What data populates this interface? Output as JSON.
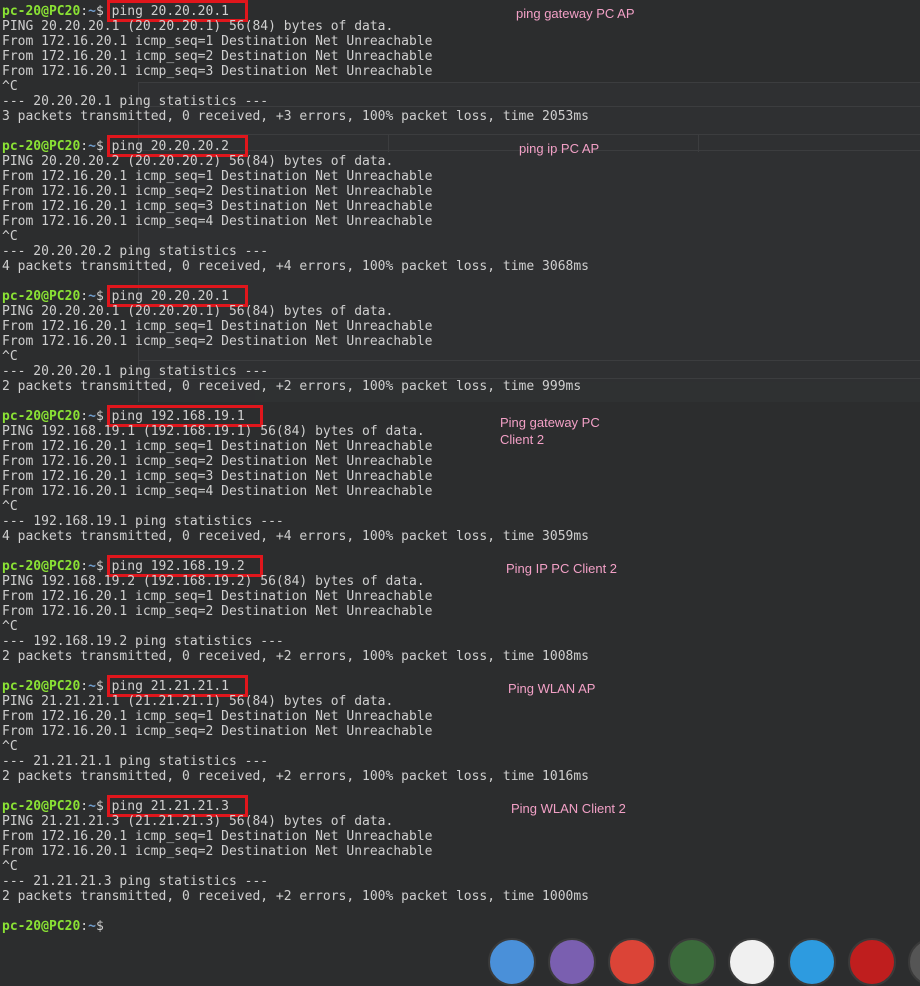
{
  "terminal": {
    "prompt_user": "pc-20@PC20",
    "prompt_path": "~",
    "blocks": [
      {
        "cmd": "ping 20.20.20.1",
        "lines": [
          "PING 20.20.20.1 (20.20.20.1) 56(84) bytes of data.",
          "From 172.16.20.1 icmp_seq=1 Destination Net Unreachable",
          "From 172.16.20.1 icmp_seq=2 Destination Net Unreachable",
          "From 172.16.20.1 icmp_seq=3 Destination Net Unreachable",
          "^C",
          "--- 20.20.20.1 ping statistics ---",
          "3 packets transmitted, 0 received, +3 errors, 100% packet loss, time 2053ms"
        ],
        "note": "ping gateway PC AP"
      },
      {
        "cmd": "ping 20.20.20.2",
        "lines": [
          "PING 20.20.20.2 (20.20.20.2) 56(84) bytes of data.",
          "From 172.16.20.1 icmp_seq=1 Destination Net Unreachable",
          "From 172.16.20.1 icmp_seq=2 Destination Net Unreachable",
          "From 172.16.20.1 icmp_seq=3 Destination Net Unreachable",
          "From 172.16.20.1 icmp_seq=4 Destination Net Unreachable",
          "^C",
          "--- 20.20.20.2 ping statistics ---",
          "4 packets transmitted, 0 received, +4 errors, 100% packet loss, time 3068ms"
        ],
        "note": "ping ip PC AP"
      },
      {
        "cmd": "ping 20.20.20.1",
        "lines": [
          "PING 20.20.20.1 (20.20.20.1) 56(84) bytes of data.",
          "From 172.16.20.1 icmp_seq=1 Destination Net Unreachable",
          "From 172.16.20.1 icmp_seq=2 Destination Net Unreachable",
          "^C",
          "--- 20.20.20.1 ping statistics ---",
          "2 packets transmitted, 0 received, +2 errors, 100% packet loss, time 999ms"
        ],
        "note": ""
      },
      {
        "cmd": "ping 192.168.19.1",
        "lines": [
          "PING 192.168.19.1 (192.168.19.1) 56(84) bytes of data.",
          "From 172.16.20.1 icmp_seq=1 Destination Net Unreachable",
          "From 172.16.20.1 icmp_seq=2 Destination Net Unreachable",
          "From 172.16.20.1 icmp_seq=3 Destination Net Unreachable",
          "From 172.16.20.1 icmp_seq=4 Destination Net Unreachable",
          "^C",
          "--- 192.168.19.1 ping statistics ---",
          "4 packets transmitted, 0 received, +4 errors, 100% packet loss, time 3059ms"
        ],
        "note": "Ping gateway PC\nClient 2"
      },
      {
        "cmd": "ping 192.168.19.2",
        "lines": [
          "PING 192.168.19.2 (192.168.19.2) 56(84) bytes of data.",
          "From 172.16.20.1 icmp_seq=1 Destination Net Unreachable",
          "From 172.16.20.1 icmp_seq=2 Destination Net Unreachable",
          "^C",
          "--- 192.168.19.2 ping statistics ---",
          "2 packets transmitted, 0 received, +2 errors, 100% packet loss, time 1008ms"
        ],
        "note": "Ping IP PC Client 2"
      },
      {
        "cmd": "ping 21.21.21.1",
        "lines": [
          "PING 21.21.21.1 (21.21.21.1) 56(84) bytes of data.",
          "From 172.16.20.1 icmp_seq=1 Destination Net Unreachable",
          "From 172.16.20.1 icmp_seq=2 Destination Net Unreachable",
          "^C",
          "--- 21.21.21.1 ping statistics ---",
          "2 packets transmitted, 0 received, +2 errors, 100% packet loss, time 1016ms"
        ],
        "note": "Ping WLAN AP"
      },
      {
        "cmd": "ping 21.21.21.3",
        "lines": [
          "PING 21.21.21.3 (21.21.21.3) 56(84) bytes of data.",
          "From 172.16.20.1 icmp_seq=1 Destination Net Unreachable",
          "From 172.16.20.1 icmp_seq=2 Destination Net Unreachable",
          "^C",
          "--- 21.21.21.3 ping statistics ---",
          "2 packets transmitted, 0 received, +2 errors, 100% packet loss, time 1000ms"
        ],
        "note": "Ping WLAN Client 2"
      }
    ]
  },
  "dock": {
    "icons": [
      {
        "name": "file-manager-icon",
        "color": "#4a90d9"
      },
      {
        "name": "folder-icon",
        "color": "#7a5fb0"
      },
      {
        "name": "chrome-icon",
        "color": "#db4437"
      },
      {
        "name": "network-tool-icon",
        "color": "#3b6a3b"
      },
      {
        "name": "inkscape-icon",
        "color": "#f0f0f0"
      },
      {
        "name": "system-monitor-icon",
        "color": "#2d9be0"
      },
      {
        "name": "filezilla-icon",
        "color": "#bf1e1e"
      },
      {
        "name": "partial-icon",
        "color": "#555555"
      }
    ]
  },
  "colors": {
    "highlight": "#e0161c",
    "note": "#f2a0c6",
    "prompt_user": "#8ae234",
    "prompt_path": "#729fcf"
  }
}
